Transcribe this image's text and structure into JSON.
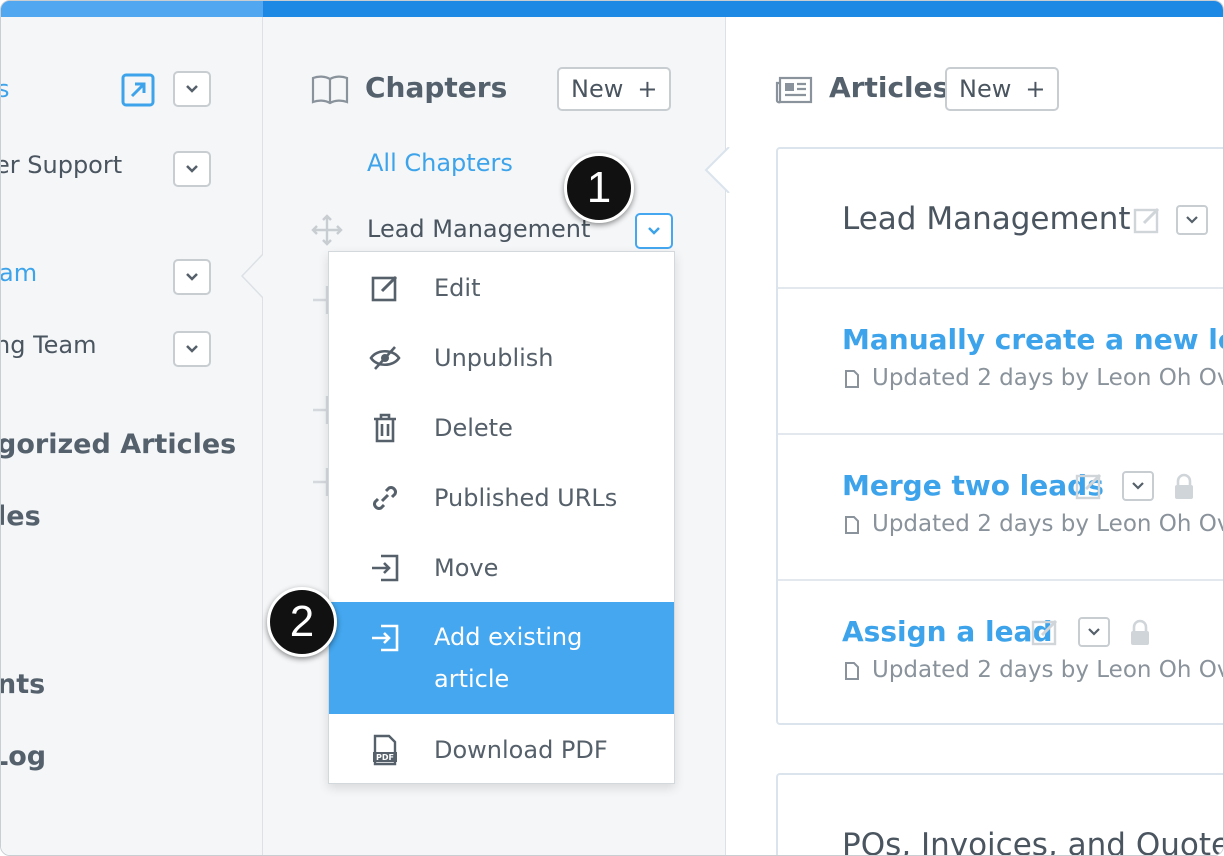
{
  "left_panel": {
    "items": [
      {
        "label": "s"
      },
      {
        "label": "er Support"
      },
      {
        "label": "am"
      },
      {
        "label": "ng Team"
      },
      {
        "label": "gorized Articles"
      },
      {
        "label": "les"
      },
      {
        "label": "nts"
      },
      {
        "label": " Log"
      }
    ]
  },
  "chapters": {
    "title": "Chapters",
    "new_button": "New",
    "all_chapters": "All Chapters",
    "selected_chapter": "Lead Management"
  },
  "menu": {
    "items": [
      {
        "label": "Edit",
        "icon": "edit-icon"
      },
      {
        "label": "Unpublish",
        "icon": "eye-slash-icon"
      },
      {
        "label": "Delete",
        "icon": "trash-icon"
      },
      {
        "label": "Published URLs",
        "icon": "link-icon"
      },
      {
        "label": "Move",
        "icon": "move-in-icon"
      },
      {
        "label_line1": "Add existing",
        "label_line2": "article",
        "icon": "add-existing-icon"
      },
      {
        "label": "Download PDF",
        "icon": "pdf-icon"
      }
    ]
  },
  "badges": {
    "one": "1",
    "two": "2"
  },
  "articles": {
    "title": "Articles",
    "new_button": "New",
    "chapter_heading": "Lead Management",
    "list": [
      {
        "title": "Manually create a new lead",
        "meta": "Updated 2 days by Leon Oh  Ov"
      },
      {
        "title": "Merge two leads",
        "meta": "Updated 2 days by Leon Oh  Ov"
      },
      {
        "title": "Assign a lead",
        "meta": "Updated 2 days by Leon Oh  Ov"
      }
    ],
    "next_chapter": "POs, Invoices, and Quotes"
  },
  "colors": {
    "accent": "#3da3ea",
    "active_menu": "#44a7ef",
    "topbar": "#1e88e5"
  }
}
